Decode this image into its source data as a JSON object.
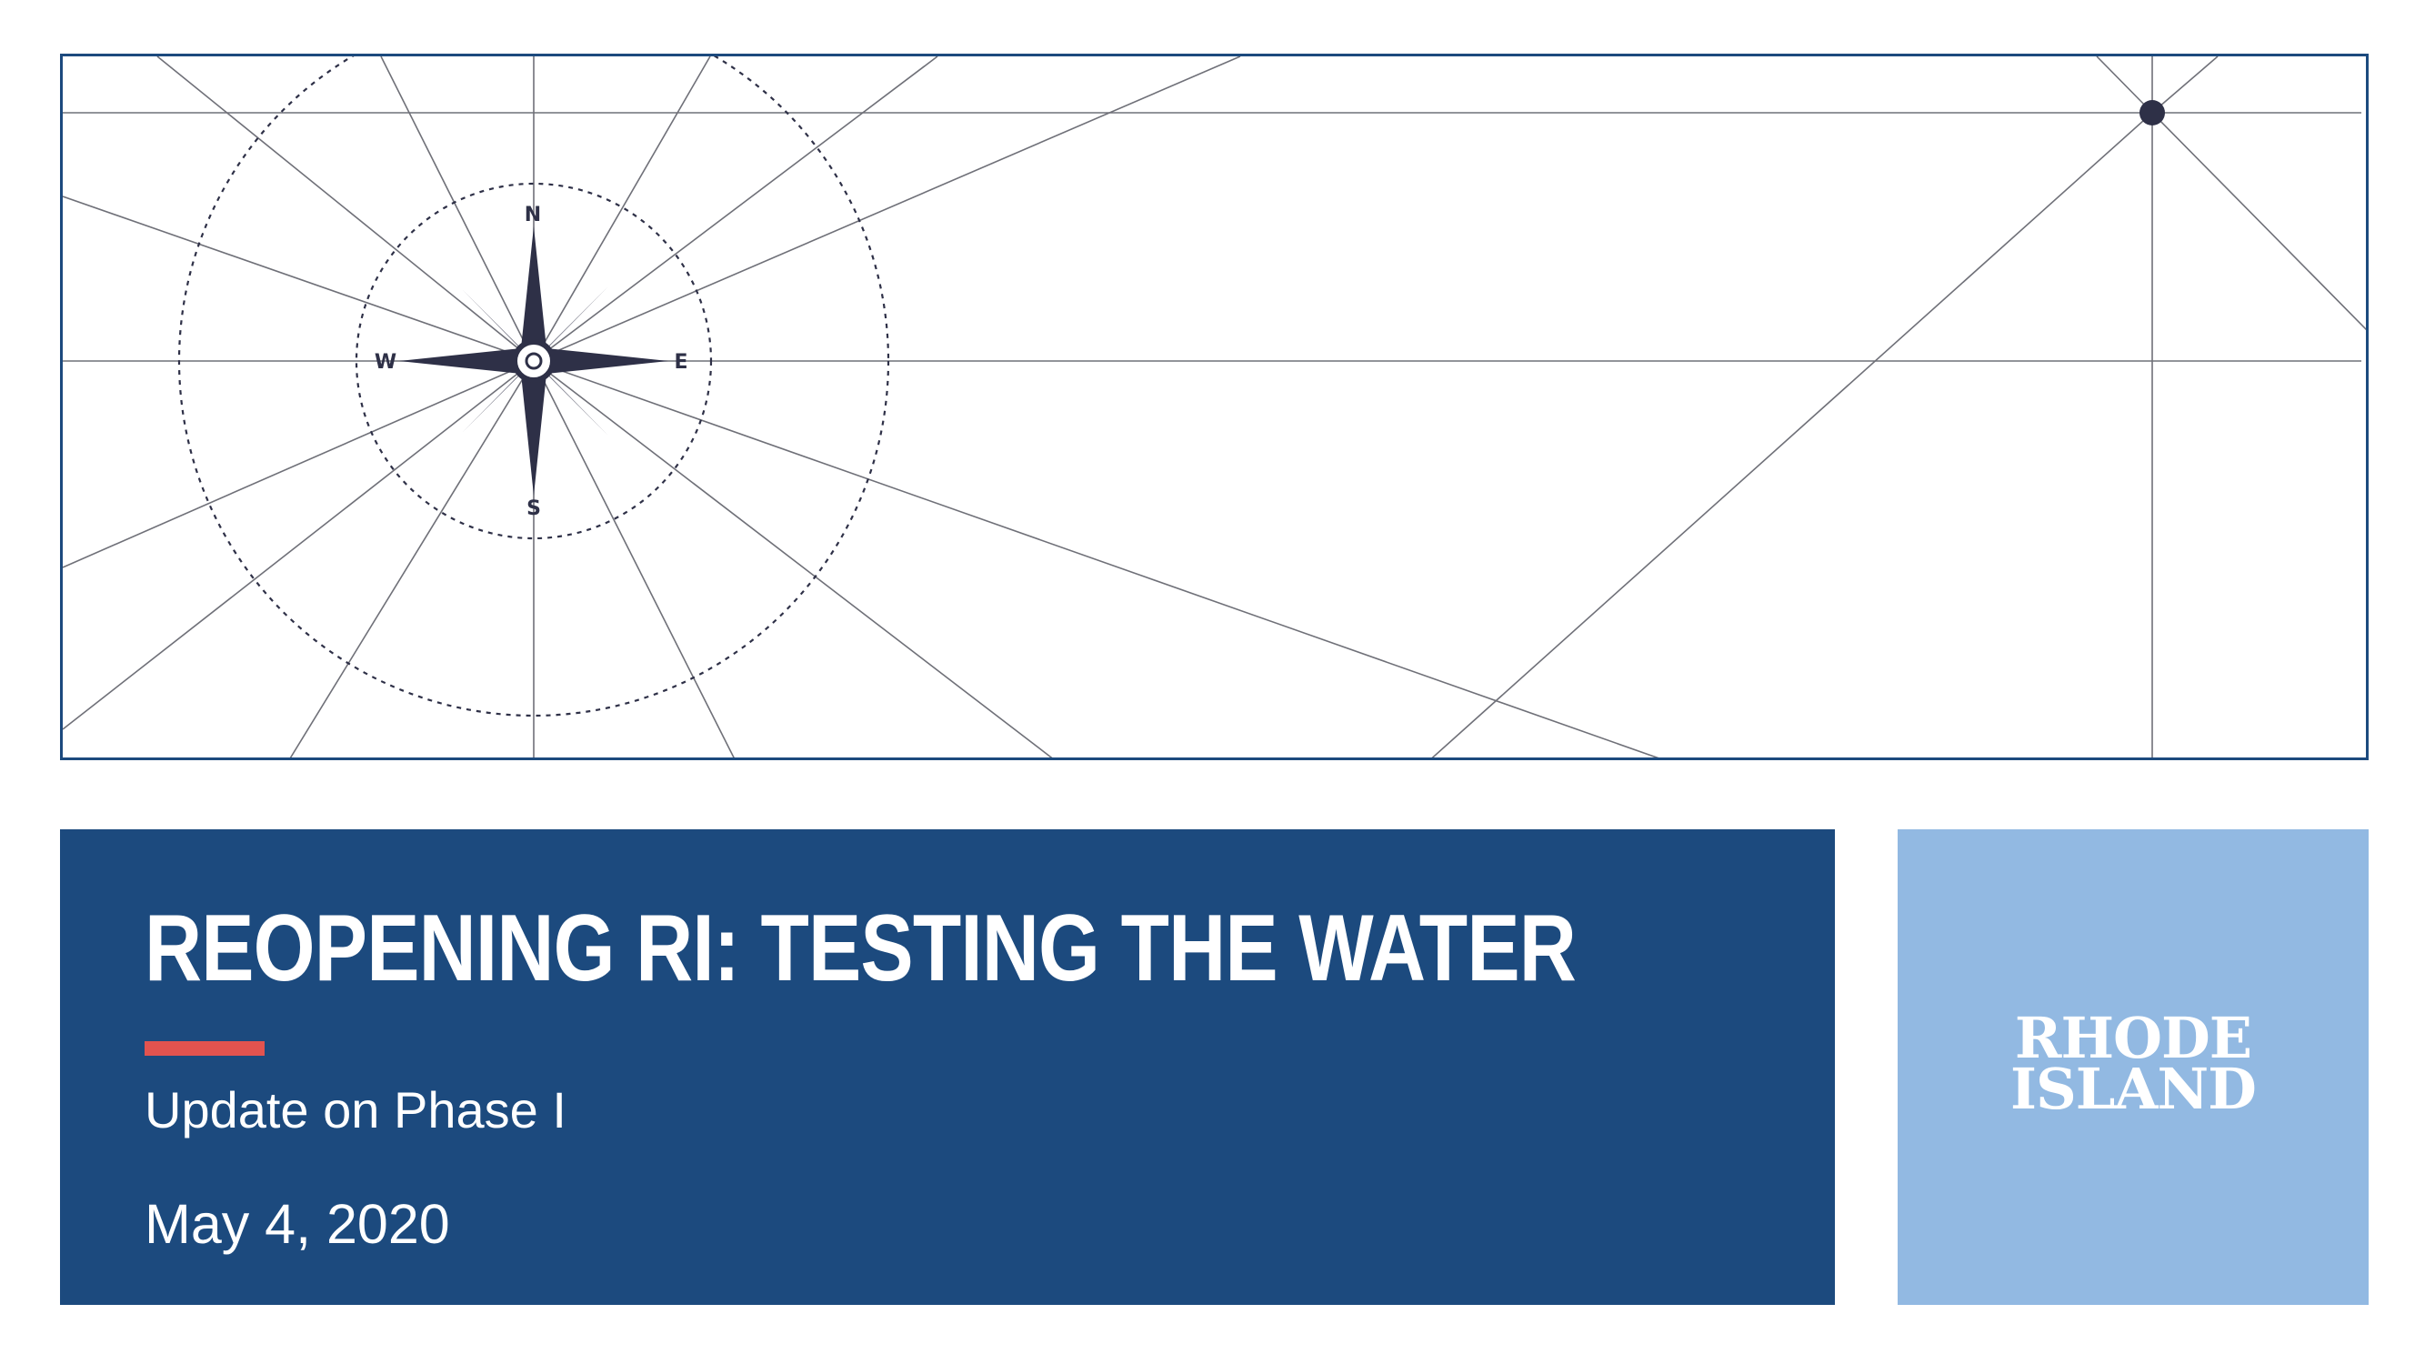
{
  "slide": {
    "title": "REOPENING RI: TESTING THE WATER",
    "subtitle": "Update on Phase I",
    "date": "May 4, 2020"
  },
  "compass": {
    "north_label": "N",
    "south_label": "S",
    "east_label": "E",
    "west_label": "W"
  },
  "logo": {
    "line1": "RHODE",
    "line2": "ISLAND"
  },
  "colors": {
    "navy": "#1c4a7e",
    "accent_red": "#e2534f",
    "light_blue": "#92b9e2",
    "compass_dark": "#2e3047",
    "line_gray": "#6f7078"
  }
}
